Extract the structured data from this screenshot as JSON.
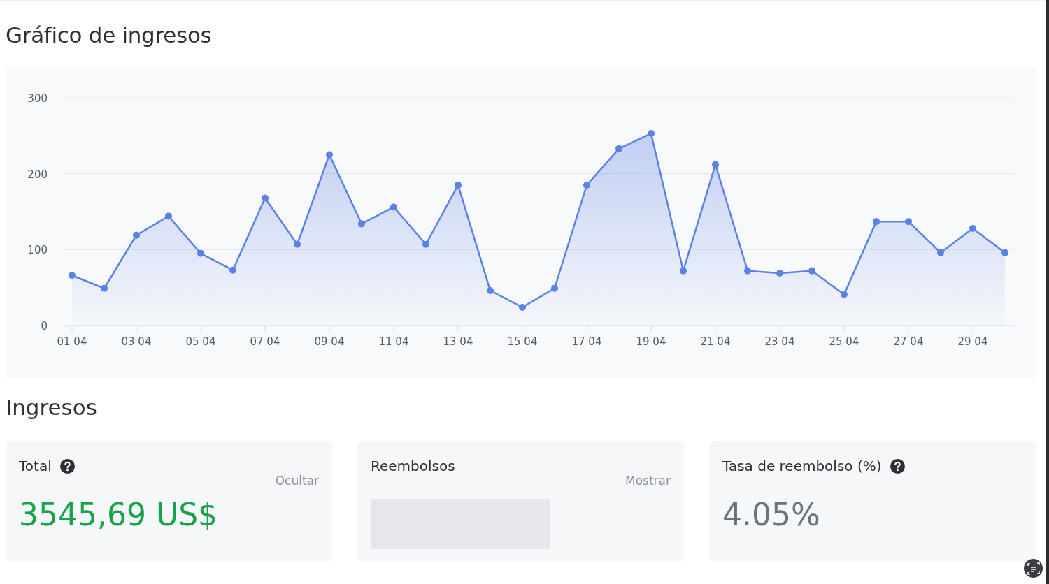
{
  "chart_section": {
    "title": "Gráfico de ingresos",
    "chart_data": {
      "type": "area",
      "categories": [
        "01 04",
        null,
        "03 04",
        null,
        "05 04",
        null,
        "07 04",
        null,
        "09 04",
        null,
        "11 04",
        null,
        "13 04",
        null,
        "15 04",
        null,
        "17 04",
        null,
        "19 04",
        null,
        "21 04",
        null,
        "23 04",
        null,
        "25 04",
        null,
        "27 04",
        null,
        "29 04",
        null
      ],
      "series": [
        {
          "color": "#5b80e6",
          "values": [
            66,
            49,
            119,
            144,
            95,
            73,
            168,
            107,
            225,
            134,
            156,
            107,
            185,
            46,
            24,
            49,
            185,
            233,
            253,
            72,
            212,
            72,
            69,
            72,
            41,
            137,
            137,
            96,
            128,
            96
          ]
        }
      ],
      "ylim": [
        0,
        300
      ],
      "yticks": [
        0,
        100,
        200,
        300
      ]
    }
  },
  "income_section": {
    "title": "Ingresos",
    "cards": [
      {
        "kind": "value",
        "label": "Total",
        "help": true,
        "toggle": "Ocultar",
        "hidden": false,
        "value": "3545,69 US$",
        "color": "#16a34a"
      },
      {
        "kind": "value",
        "label": "Reembolsos",
        "help": false,
        "toggle": "Mostrar",
        "hidden": true
      },
      {
        "kind": "value",
        "label": "Tasa de reembolso (%)",
        "help": true,
        "hidden": false,
        "value": "4.05%",
        "color": "#6b7280"
      }
    ]
  }
}
